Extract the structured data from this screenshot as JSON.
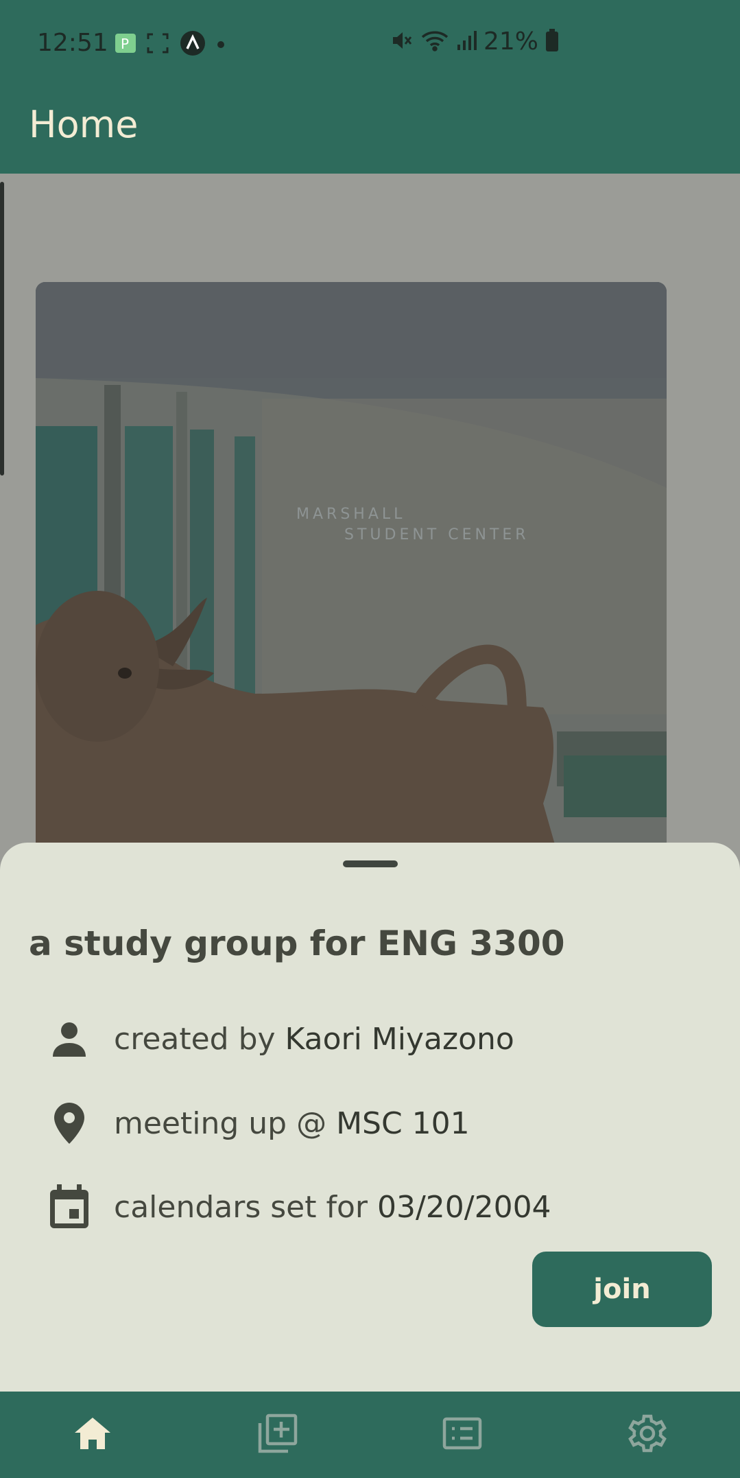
{
  "status_bar": {
    "time": "12:51",
    "battery": "21%"
  },
  "app_bar": {
    "title": "Home"
  },
  "hero": {
    "image": "statue-student-center"
  },
  "sheet": {
    "title": "a study group for ENG 3300",
    "creator_prefix": "created by ",
    "creator_name": "Kaori Miyazono",
    "location_prefix": "meeting up @ ",
    "location_name": "MSC 101",
    "date_prefix": "calendars set for ",
    "date_value": "03/20/2004",
    "join_label": "join"
  },
  "nav": {
    "items": [
      {
        "icon": "home-icon"
      },
      {
        "icon": "add-group-icon"
      },
      {
        "icon": "list-icon"
      },
      {
        "icon": "settings-icon"
      }
    ]
  },
  "colors": {
    "primary": "#2e6b5c",
    "on_primary": "#f3ecd4",
    "sheet_bg": "#e0e3d6",
    "scrim_bg": "#9b9c97"
  }
}
